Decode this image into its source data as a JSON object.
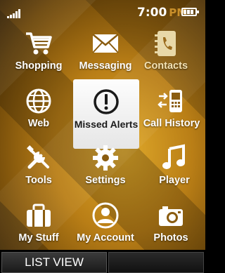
{
  "status": {
    "time": "7:00",
    "ampm": "PM",
    "signal_icon": "signal-bars-icon",
    "battery_icon": "battery-icon"
  },
  "menu": {
    "items": [
      {
        "label": "Shopping",
        "icon": "shopping-cart-icon"
      },
      {
        "label": "Messaging",
        "icon": "envelope-icon"
      },
      {
        "label": "Contacts",
        "icon": "address-book-icon"
      },
      {
        "label": "Web",
        "icon": "globe-icon"
      },
      {
        "label": "Missed Alerts",
        "icon": "exclamation-circle-icon",
        "selected": true
      },
      {
        "label": "Call History",
        "icon": "call-history-icon"
      },
      {
        "label": "Tools",
        "icon": "tools-icon"
      },
      {
        "label": "Settings",
        "icon": "gear-icon"
      },
      {
        "label": "Player",
        "icon": "music-note-icon"
      },
      {
        "label": "My Stuff",
        "icon": "briefcase-icon"
      },
      {
        "label": "My Account",
        "icon": "account-icon"
      },
      {
        "label": "Photos",
        "icon": "camera-icon"
      }
    ]
  },
  "softkeys": {
    "left": "LIST VIEW",
    "right": ""
  }
}
